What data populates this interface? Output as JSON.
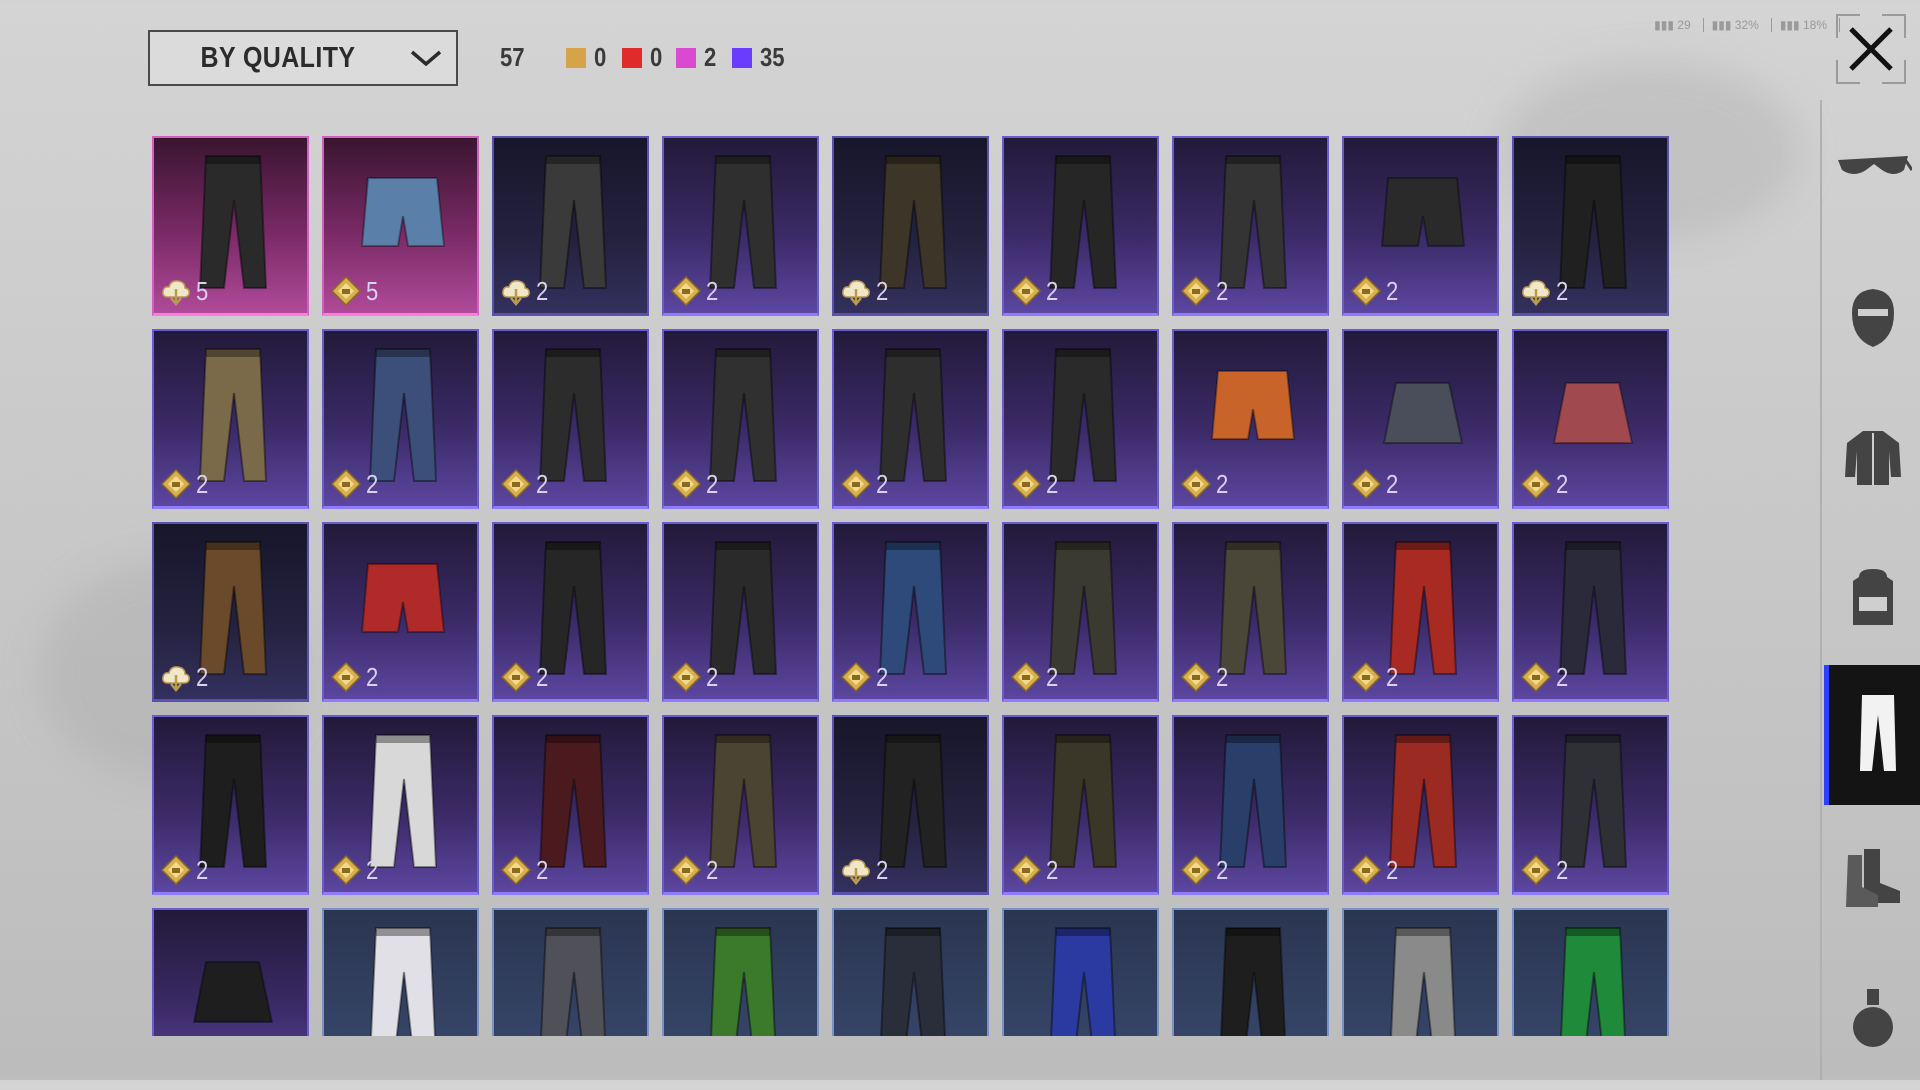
{
  "toolbar": {
    "sort_label": "BY QUALITY",
    "total_count": "57",
    "filters": [
      {
        "name": "gold-quality",
        "color": "#d6a24a",
        "count": "0"
      },
      {
        "name": "red-quality",
        "color": "#e02b2b",
        "count": "0"
      },
      {
        "name": "pink-quality",
        "color": "#d94ad0",
        "count": "2"
      },
      {
        "name": "purple-quality",
        "color": "#6a3cff",
        "count": "35"
      }
    ]
  },
  "close_icon": "close-icon",
  "sidebar": {
    "tabs": [
      {
        "icon": "glasses-icon",
        "active": false
      },
      {
        "icon": "mask-icon",
        "active": false
      },
      {
        "icon": "jacket-icon",
        "active": false
      },
      {
        "icon": "backpack-icon",
        "active": false
      },
      {
        "icon": "pants-icon",
        "active": true
      },
      {
        "icon": "boots-icon",
        "active": false
      },
      {
        "icon": "gloves-icon",
        "active": false
      }
    ]
  },
  "items": [
    {
      "icon": "cloud-icon",
      "count": "5",
      "quality": "pink"
    },
    {
      "icon": "diamond-icon",
      "count": "5",
      "quality": "pink"
    },
    {
      "icon": "cloud-icon",
      "count": "2",
      "quality": "dark"
    },
    {
      "icon": "diamond-icon",
      "count": "2",
      "quality": "purple"
    },
    {
      "icon": "cloud-icon",
      "count": "2",
      "quality": "dark"
    },
    {
      "icon": "diamond-icon",
      "count": "2",
      "quality": "purple"
    },
    {
      "icon": "diamond-icon",
      "count": "2",
      "quality": "purple"
    },
    {
      "icon": "diamond-icon",
      "count": "2",
      "quality": "purple"
    },
    {
      "icon": "cloud-icon",
      "count": "2",
      "quality": "dark"
    },
    {
      "icon": "diamond-icon",
      "count": "2",
      "quality": "purple"
    },
    {
      "icon": "diamond-icon",
      "count": "2",
      "quality": "purple"
    },
    {
      "icon": "diamond-icon",
      "count": "2",
      "quality": "purple"
    },
    {
      "icon": "diamond-icon",
      "count": "2",
      "quality": "purple"
    },
    {
      "icon": "diamond-icon",
      "count": "2",
      "quality": "purple"
    },
    {
      "icon": "diamond-icon",
      "count": "2",
      "quality": "purple"
    },
    {
      "icon": "diamond-icon",
      "count": "2",
      "quality": "purple"
    },
    {
      "icon": "diamond-icon",
      "count": "2",
      "quality": "purple"
    },
    {
      "icon": "diamond-icon",
      "count": "2",
      "quality": "purple"
    },
    {
      "icon": "cloud-icon",
      "count": "2",
      "quality": "dark"
    },
    {
      "icon": "diamond-icon",
      "count": "2",
      "quality": "purple"
    },
    {
      "icon": "diamond-icon",
      "count": "2",
      "quality": "purple"
    },
    {
      "icon": "diamond-icon",
      "count": "2",
      "quality": "purple"
    },
    {
      "icon": "diamond-icon",
      "count": "2",
      "quality": "purple"
    },
    {
      "icon": "diamond-icon",
      "count": "2",
      "quality": "purple"
    },
    {
      "icon": "diamond-icon",
      "count": "2",
      "quality": "purple"
    },
    {
      "icon": "diamond-icon",
      "count": "2",
      "quality": "purple"
    },
    {
      "icon": "diamond-icon",
      "count": "2",
      "quality": "purple"
    },
    {
      "icon": "diamond-icon",
      "count": "2",
      "quality": "purple"
    },
    {
      "icon": "diamond-icon",
      "count": "2",
      "quality": "purple"
    },
    {
      "icon": "diamond-icon",
      "count": "2",
      "quality": "purple"
    },
    {
      "icon": "diamond-icon",
      "count": "2",
      "quality": "purple"
    },
    {
      "icon": "cloud-icon",
      "count": "2",
      "quality": "dark"
    },
    {
      "icon": "diamond-icon",
      "count": "2",
      "quality": "purple"
    },
    {
      "icon": "diamond-icon",
      "count": "2",
      "quality": "purple"
    },
    {
      "icon": "diamond-icon",
      "count": "2",
      "quality": "purple"
    },
    {
      "icon": "diamond-icon",
      "count": "2",
      "quality": "purple"
    },
    {
      "icon": "",
      "count": "",
      "quality": "purple"
    },
    {
      "icon": "",
      "count": "",
      "quality": "blue"
    },
    {
      "icon": "",
      "count": "",
      "quality": "blue"
    },
    {
      "icon": "",
      "count": "",
      "quality": "blue"
    },
    {
      "icon": "",
      "count": "",
      "quality": "blue"
    },
    {
      "icon": "",
      "count": "",
      "quality": "blue"
    },
    {
      "icon": "",
      "count": "",
      "quality": "blue"
    },
    {
      "icon": "",
      "count": "",
      "quality": "blue"
    },
    {
      "icon": "",
      "count": "",
      "quality": "blue"
    }
  ]
}
